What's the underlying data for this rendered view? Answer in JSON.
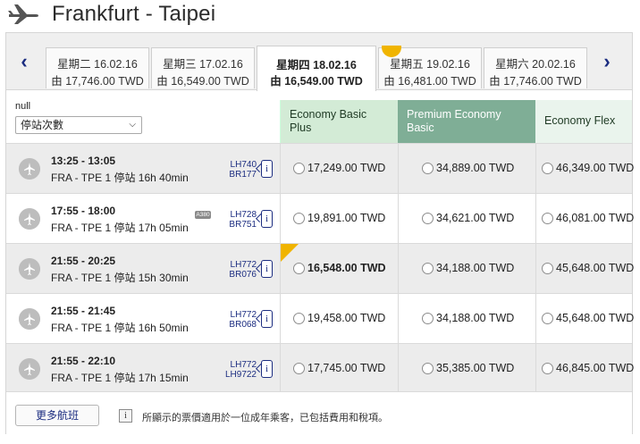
{
  "header": {
    "title": "Frankfurt - Taipei",
    "icon": "plane-icon"
  },
  "date_nav": {
    "prev_arrow": "‹",
    "next_arrow": "›",
    "tabs": [
      {
        "date": "星期二 16.02.16",
        "price": "由  17,746.00  TWD",
        "selected": false
      },
      {
        "date": "星期三 17.02.16",
        "price": "由  16,549.00  TWD",
        "selected": false
      },
      {
        "date": "星期四 18.02.16",
        "price": "由  16,549.00  TWD",
        "selected": true
      },
      {
        "date": "星期五 19.02.16",
        "price": "由  16,481.00  TWD",
        "selected": false,
        "best": true
      },
      {
        "date": "星期六 20.02.16",
        "price": "由  17,746.00  TWD",
        "selected": false
      }
    ]
  },
  "filter": {
    "label": "null",
    "selected": "停站次數"
  },
  "fare_classes": {
    "basic": "Economy Basic Plus",
    "premium": "Premium Economy Basic",
    "flex": "Economy Flex"
  },
  "flights": [
    {
      "times": "13:25 - 13:05",
      "route": "FRA - TPE  1 停站  16h 40min",
      "aircraft": "",
      "flight_1": "LH740",
      "flight_2": "BR177",
      "info": "i",
      "fares": {
        "basic": "17,249.00 TWD",
        "premium": "34,889.00 TWD",
        "flex": "46,349.00 TWD"
      },
      "best_basic": false
    },
    {
      "times": "17:55 - 18:00",
      "route": "FRA - TPE  1 停站  17h 05min",
      "aircraft": "A380",
      "flight_1": "LH728",
      "flight_2": "BR751",
      "info": "i",
      "fares": {
        "basic": "19,891.00 TWD",
        "premium": "34,621.00 TWD",
        "flex": "46,081.00 TWD"
      },
      "best_basic": false
    },
    {
      "times": "21:55 - 20:25",
      "route": "FRA - TPE  1 停站  15h 30min",
      "aircraft": "",
      "flight_1": "LH772",
      "flight_2": "BR076",
      "info": "i",
      "fares": {
        "basic": "16,548.00 TWD",
        "premium": "34,188.00 TWD",
        "flex": "45,648.00 TWD"
      },
      "best_basic": true
    },
    {
      "times": "21:55 - 21:45",
      "route": "FRA - TPE  1 停站  16h 50min",
      "aircraft": "",
      "flight_1": "LH772",
      "flight_2": "BR068",
      "info": "i",
      "fares": {
        "basic": "19,458.00 TWD",
        "premium": "34,188.00 TWD",
        "flex": "45,648.00 TWD"
      },
      "best_basic": false
    },
    {
      "times": "21:55 - 22:10",
      "route": "FRA - TPE  1 停站  17h 15min",
      "aircraft": "",
      "flight_1": "LH772",
      "flight_2": "LH9722",
      "info": "i",
      "fares": {
        "basic": "17,745.00 TWD",
        "premium": "35,385.00 TWD",
        "flex": "46,845.00 TWD"
      },
      "best_basic": false
    }
  ],
  "footer": {
    "more_button": "更多航班",
    "info_icon": "i",
    "note": "所顯示的票價適用於一位成年乘客，已包括費用和稅項。"
  },
  "colors": {
    "accent_navy": "#1b2c80",
    "best_flag": "#f0b400",
    "basic_header": "#d3ebd6",
    "premium_header": "#7fae96",
    "flex_header": "#eaf4ed"
  }
}
